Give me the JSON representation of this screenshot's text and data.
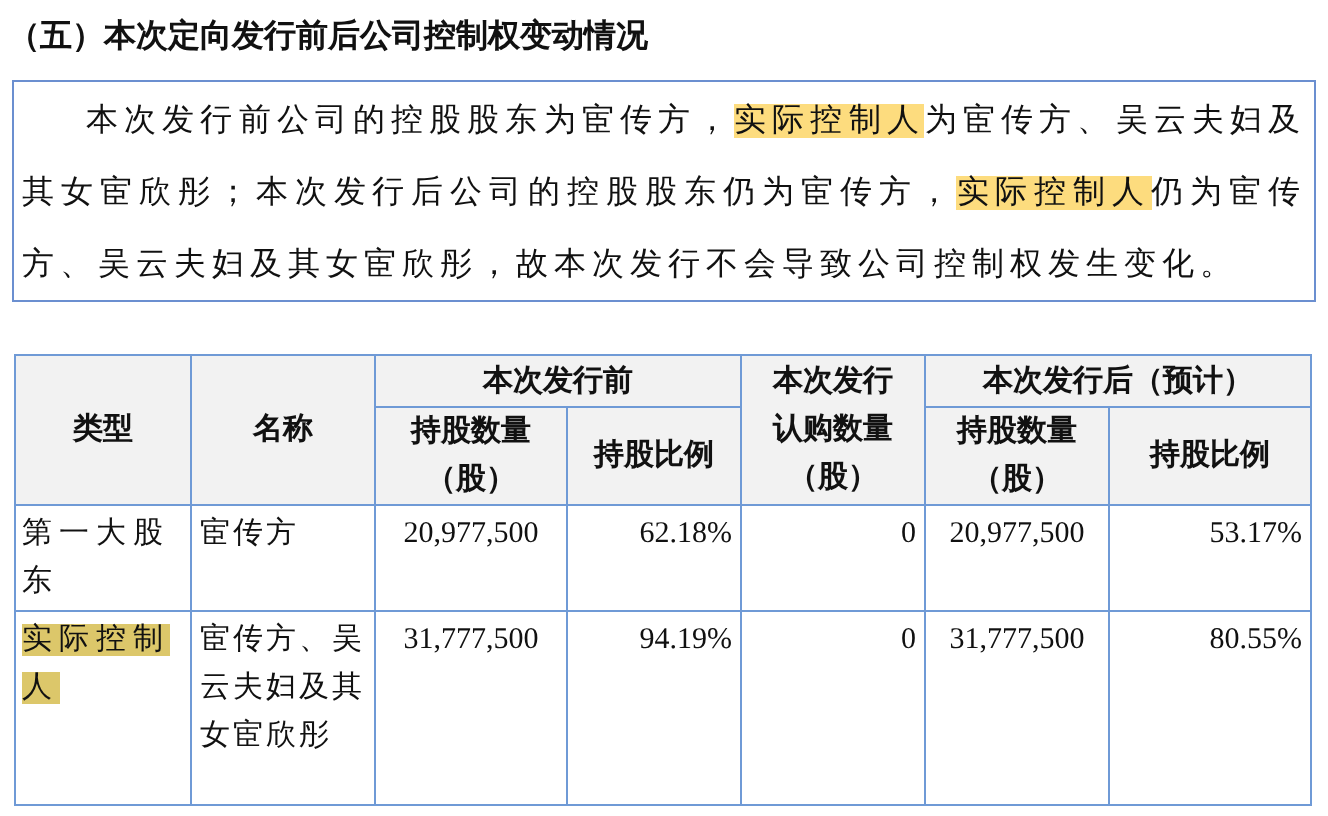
{
  "heading": "（五）本次定向发行前后公司控制权变动情况",
  "paragraph": [
    {
      "text": "本次发行前公司的控股股东为宦传方，",
      "highlighted": false
    },
    {
      "text": "实际控制人",
      "highlighted": true
    },
    {
      "text": "为宦传方、吴云夫妇及其女宦欣彤；本次发行后公司的控股股东仍为宦传方，",
      "highlighted": false
    },
    {
      "text": "实际控制人",
      "highlighted": true
    },
    {
      "text": "仍为宦传方、吴云夫妇及其女宦欣彤，故本次发行不会导致公司控制权发生变化。",
      "highlighted": false
    }
  ],
  "table": {
    "header_rows": [
      [
        {
          "lines": [
            "类型"
          ],
          "rowspan": 2
        },
        {
          "lines": [
            "名称"
          ],
          "rowspan": 2
        },
        {
          "lines": [
            "本次发行前"
          ],
          "colspan": 2
        },
        {
          "lines": [
            "本次发行",
            "认购数量",
            "（股）"
          ],
          "rowspan": 2
        },
        {
          "lines": [
            "本次发行后（预计）"
          ],
          "colspan": 2
        }
      ],
      [
        {
          "lines": [
            "持股数量",
            "（股）"
          ]
        },
        {
          "lines": [
            "持股比例"
          ]
        },
        {
          "lines": [
            "持股数量",
            "（股）"
          ]
        },
        {
          "lines": [
            "持股比例"
          ]
        }
      ]
    ],
    "rows": [
      {
        "type_highlighted": false,
        "cells": [
          "第一大股东",
          "宦传方",
          "20,977,500",
          "62.18%",
          "0",
          "20,977,500",
          "53.17%"
        ]
      },
      {
        "type_highlighted": true,
        "cells": [
          "实际控制人",
          "宦传方、吴云夫妇及其女宦欣彤",
          "31,777,500",
          "94.19%",
          "0",
          "31,777,500",
          "80.55%"
        ]
      }
    ]
  }
}
